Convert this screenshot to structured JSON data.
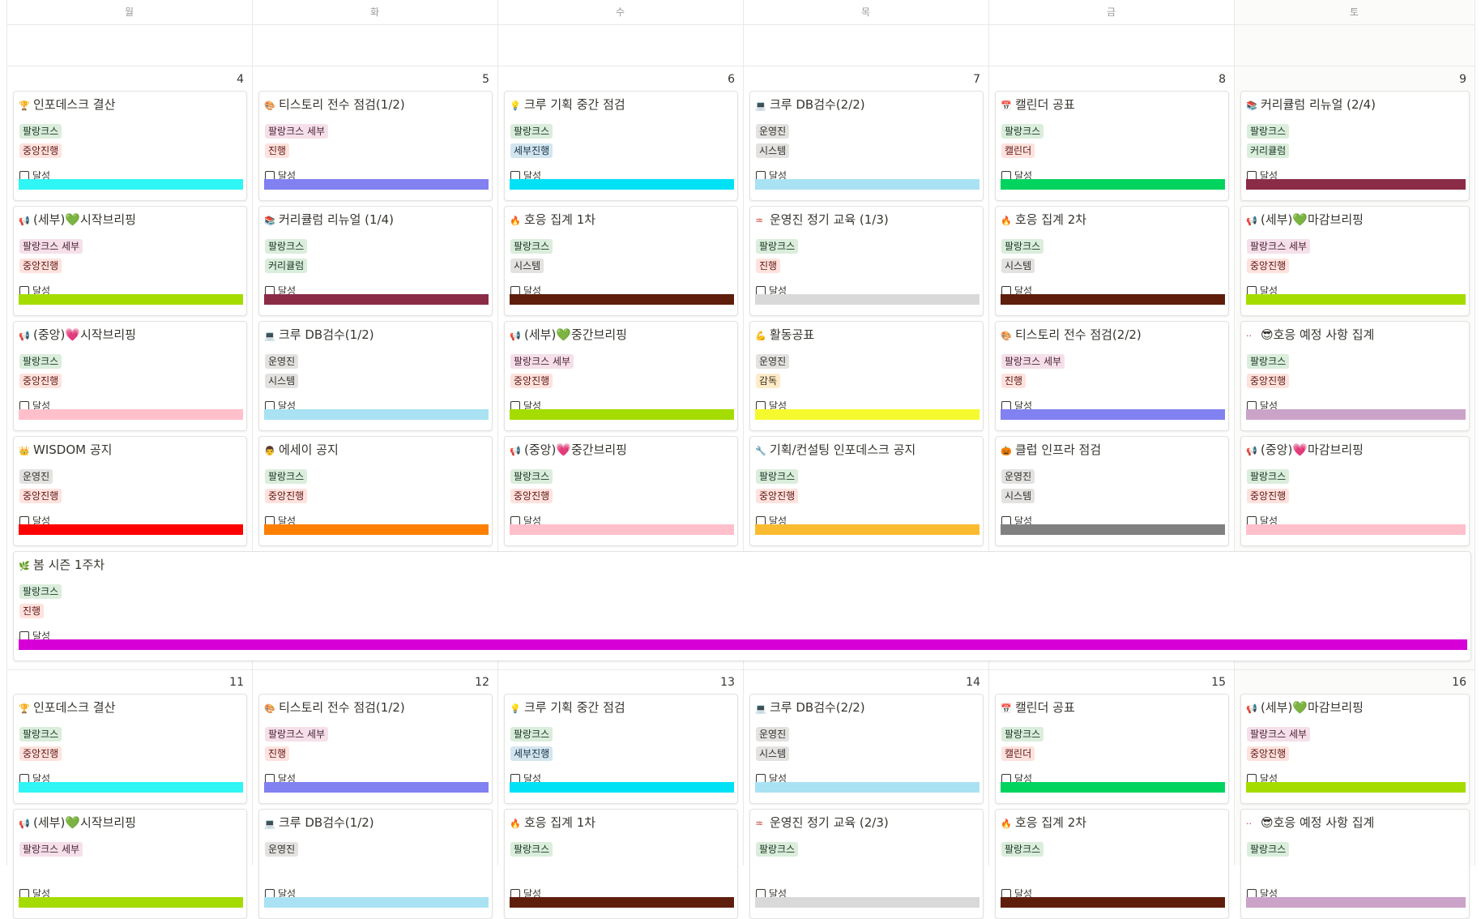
{
  "weekdays": [
    "월",
    "화",
    "수",
    "목",
    "금",
    "토"
  ],
  "check_label": "달성",
  "tag_palette": {
    "팔랑크스": [
      "#dbeddb",
      "#1c3829"
    ],
    "팔랑크스 세부": [
      "#f5e0e9",
      "#4c2337"
    ],
    "중앙진행": [
      "#ffe2dd",
      "#5d1715"
    ],
    "세부진행": [
      "#d3e5ef",
      "#183347"
    ],
    "진행": [
      "#ffe2dd",
      "#5d1715"
    ],
    "운영진": [
      "#e3e2e0",
      "#32302c"
    ],
    "시스템": [
      "#e3e2e0",
      "#32302c"
    ],
    "커리큘럼": [
      "#dbeddb",
      "#1c3829"
    ],
    "캘린더": [
      "#ffe2dd",
      "#5d1715"
    ],
    "감독": [
      "#fdecc8",
      "#402c1b"
    ]
  },
  "weeks": [
    {
      "days": [
        "4",
        "5",
        "6",
        "7",
        "8",
        "9"
      ],
      "rows": [
        [
          {
            "icon": "🏆",
            "title": "인포데스크 결산",
            "tags": [
              "팔랑크스",
              "중앙진행"
            ],
            "color": "#2ff5f5"
          },
          {
            "icon": "🎨",
            "title": "티스토리 전수 점검(1/2)",
            "tags": [
              "팔랑크스 세부",
              "진행"
            ],
            "color": "#8181f1"
          },
          {
            "icon": "💡",
            "title": "크루 기획 중간 점검",
            "tags": [
              "팔랑크스",
              "세부진행"
            ],
            "color": "#00e1f5"
          },
          {
            "icon": "💻",
            "title": "크루 DB검수(2/2)",
            "tags": [
              "운영진",
              "시스템"
            ],
            "color": "#a9e2f3"
          },
          {
            "icon": "📅",
            "title": "캘린더 공표",
            "tags": [
              "팔랑크스",
              "캘린더"
            ],
            "color": "#00d45f"
          },
          {
            "icon": "📚",
            "title": "커리큘럼 리뉴얼 (2/4)",
            "tags": [
              "팔랑크스",
              "커리큘럼"
            ],
            "color": "#8b2c47"
          }
        ],
        [
          {
            "icon": "📢",
            "title": "(세부)💚시작브리핑",
            "tags": [
              "팔랑크스 세부",
              "중앙진행"
            ],
            "color": "#a5dc00"
          },
          {
            "icon": "📚",
            "title": "커리큘럼 리뉴얼 (1/4)",
            "tags": [
              "팔랑크스",
              "커리큘럼"
            ],
            "color": "#8b2c47"
          },
          {
            "icon": "🔥",
            "title": "호응 집계 1차",
            "tags": [
              "팔랑크스",
              "시스템"
            ],
            "color": "#5e1e0b"
          },
          {
            "icon": "♒",
            "title": "운영진 정기 교육 (1/3)",
            "tags": [
              "팔랑크스",
              "진행"
            ],
            "color": "#d9d9d9"
          },
          {
            "icon": "🔥",
            "title": "호응 집계 2차",
            "tags": [
              "팔랑크스",
              "시스템"
            ],
            "color": "#5e1e0b"
          },
          {
            "icon": "📢",
            "title": "(세부)💚마감브리핑",
            "tags": [
              "팔랑크스 세부",
              "중앙진행"
            ],
            "color": "#a5dc00"
          }
        ],
        [
          {
            "icon": "📢",
            "title": "(중앙)💗시작브리핑",
            "tags": [
              "팔랑크스",
              "중앙진행"
            ],
            "color": "#ffc0cb"
          },
          {
            "icon": "💻",
            "title": "크루 DB검수(1/2)",
            "tags": [
              "운영진",
              "시스템"
            ],
            "color": "#a9e2f3"
          },
          {
            "icon": "📢",
            "title": "(세부)💚중간브리핑",
            "tags": [
              "팔랑크스 세부",
              "중앙진행"
            ],
            "color": "#a5dc00"
          },
          {
            "icon": "💪",
            "title": "활동공표",
            "tags": [
              "운영진",
              "감독"
            ],
            "color": "#f4fa2e"
          },
          {
            "icon": "🎨",
            "title": "티스토리 전수 점검(2/2)",
            "tags": [
              "팔랑크스 세부",
              "진행"
            ],
            "color": "#8181f1"
          },
          {
            "icon": "··",
            "title": "😎호응 예정 사항 집계",
            "tags": [
              "팔랑크스",
              "중앙진행"
            ],
            "color": "#cba3c8"
          }
        ],
        [
          {
            "icon": "👑",
            "title": "WISDOM 공지",
            "tags": [
              "운영진",
              "중앙진행"
            ],
            "color": "#ff0000"
          },
          {
            "icon": "👨",
            "title": "에세이 공지",
            "tags": [
              "팔랑크스",
              "중앙진행"
            ],
            "color": "#ff7f00"
          },
          {
            "icon": "📢",
            "title": "(중앙)💗중간브리핑",
            "tags": [
              "팔랑크스",
              "중앙진행"
            ],
            "color": "#ffc0cb"
          },
          {
            "icon": "🔧",
            "title": "기획/컨설팅 인포데스크 공지",
            "tags": [
              "팔랑크스",
              "중앙진행"
            ],
            "color": "#fbbb30"
          },
          {
            "icon": "🎃",
            "title": "클럽 인프라 점검",
            "tags": [
              "운영진",
              "시스템"
            ],
            "color": "#808080"
          },
          {
            "icon": "📢",
            "title": "(중앙)💗마감브리핑",
            "tags": [
              "팔랑크스",
              "중앙진행"
            ],
            "color": "#ffc0cb"
          }
        ]
      ],
      "wide": {
        "icon": "🌿",
        "title": "봄 시즌 1주차",
        "tags": [
          "팔랑크스",
          "진행"
        ],
        "color": "#d600d6"
      }
    },
    {
      "days": [
        "11",
        "12",
        "13",
        "14",
        "15",
        "16"
      ],
      "rows": [
        [
          {
            "icon": "🏆",
            "title": "인포데스크 결산",
            "tags": [
              "팔랑크스",
              "중앙진행"
            ],
            "color": "#2ff5f5"
          },
          {
            "icon": "🎨",
            "title": "티스토리 전수 점검(1/2)",
            "tags": [
              "팔랑크스 세부",
              "진행"
            ],
            "color": "#8181f1"
          },
          {
            "icon": "💡",
            "title": "크루 기획 중간 점검",
            "tags": [
              "팔랑크스",
              "세부진행"
            ],
            "color": "#00e1f5"
          },
          {
            "icon": "💻",
            "title": "크루 DB검수(2/2)",
            "tags": [
              "운영진",
              "시스템"
            ],
            "color": "#a9e2f3"
          },
          {
            "icon": "📅",
            "title": "캘린더 공표",
            "tags": [
              "팔랑크스",
              "캘린더"
            ],
            "color": "#00d45f"
          },
          {
            "icon": "📢",
            "title": "(세부)💚마감브리핑",
            "tags": [
              "팔랑크스 세부",
              "중앙진행"
            ],
            "color": "#a5dc00"
          }
        ],
        [
          {
            "icon": "📢",
            "title": "(세부)💚시작브리핑",
            "tags": [
              "팔랑크스 세부"
            ],
            "color": "#a5dc00"
          },
          {
            "icon": "💻",
            "title": "크루 DB검수(1/2)",
            "tags": [
              "운영진"
            ],
            "color": "#a9e2f3"
          },
          {
            "icon": "🔥",
            "title": "호응 집계 1차",
            "tags": [
              "팔랑크스"
            ],
            "color": "#5e1e0b"
          },
          {
            "icon": "♒",
            "title": "운영진 정기 교육 (2/3)",
            "tags": [
              "팔랑크스"
            ],
            "color": "#d9d9d9"
          },
          {
            "icon": "🔥",
            "title": "호응 집계 2차",
            "tags": [
              "팔랑크스"
            ],
            "color": "#5e1e0b"
          },
          {
            "icon": "··",
            "title": "😎호응 예정 사항 집계",
            "tags": [
              "팔랑크스"
            ],
            "color": "#cba3c8"
          }
        ]
      ]
    }
  ]
}
